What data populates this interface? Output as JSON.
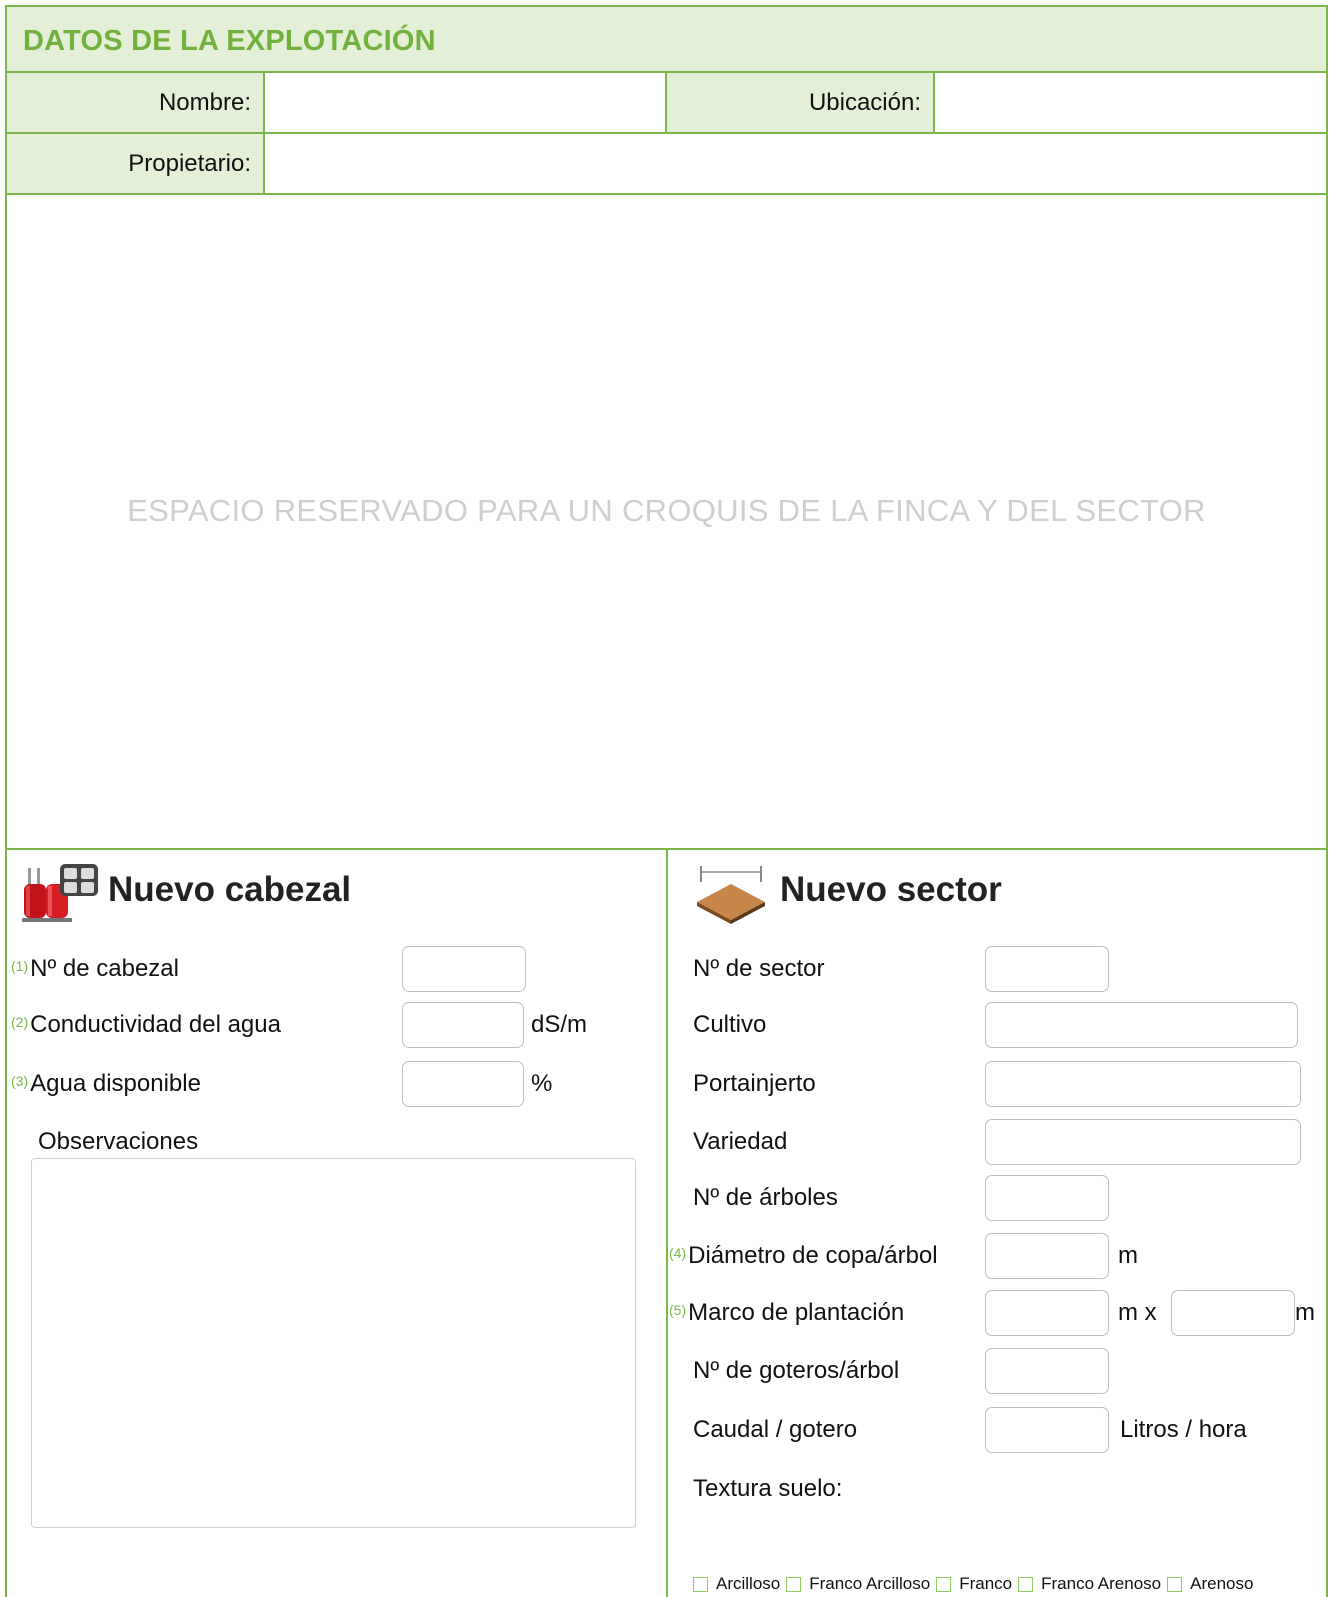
{
  "header": {
    "title": "DATOS DE LA EXPLOTACIÓN"
  },
  "farm": {
    "nombre_label": "Nombre:",
    "nombre_value": "",
    "ubicacion_label": "Ubicación:",
    "ubicacion_value": "",
    "propietario_label": "Propietario:",
    "propietario_value": ""
  },
  "sketch": {
    "placeholder": "ESPACIO RESERVADO PARA UN CROQUIS DE LA FINCA Y DEL SECTOR"
  },
  "cabezal": {
    "title": "Nuevo cabezal",
    "fields": [
      {
        "num": "(1)",
        "label": "Nº de cabezal",
        "unit": "",
        "value": ""
      },
      {
        "num": "(2)",
        "label": "Conductividad del agua",
        "unit": "dS/m",
        "value": ""
      },
      {
        "num": "(3)",
        "label": "Agua disponible",
        "unit": "%",
        "value": ""
      }
    ],
    "observaciones_label": "Observaciones",
    "observaciones_value": ""
  },
  "sector": {
    "title": "Nuevo sector",
    "fields": [
      {
        "num": "",
        "label": "Nº de sector",
        "unit": "",
        "value": ""
      },
      {
        "num": "",
        "label": "Cultivo",
        "unit": "",
        "value": ""
      },
      {
        "num": "",
        "label": "Portainjerto",
        "unit": "",
        "value": ""
      },
      {
        "num": "",
        "label": "Variedad",
        "unit": "",
        "value": ""
      },
      {
        "num": "",
        "label": "Nº de árboles",
        "unit": "",
        "value": ""
      },
      {
        "num": "(4)",
        "label": "Diámetro de copa/árbol",
        "unit": "m",
        "value": ""
      },
      {
        "num": "(5)",
        "label": "Marco de plantación",
        "unit": "m x",
        "unit2": "m",
        "value": "",
        "value2": ""
      },
      {
        "num": "",
        "label": "Nº de goteros/árbol",
        "unit": "",
        "value": ""
      },
      {
        "num": "",
        "label": "Caudal / gotero",
        "unit": "Litros / hora",
        "value": ""
      }
    ],
    "textura_label": "Textura suelo:",
    "textura_options": [
      "Arcilloso",
      "Franco Arcilloso",
      "Franco",
      "Franco Arenoso",
      "Arenoso"
    ]
  },
  "colors": {
    "accent_green": "#7ab648",
    "header_bg": "#e3efd6",
    "placeholder_text": "#cfcfcf"
  },
  "icons": {
    "cabezal": "irrigation-head-icon",
    "sector": "soil-plot-icon"
  }
}
